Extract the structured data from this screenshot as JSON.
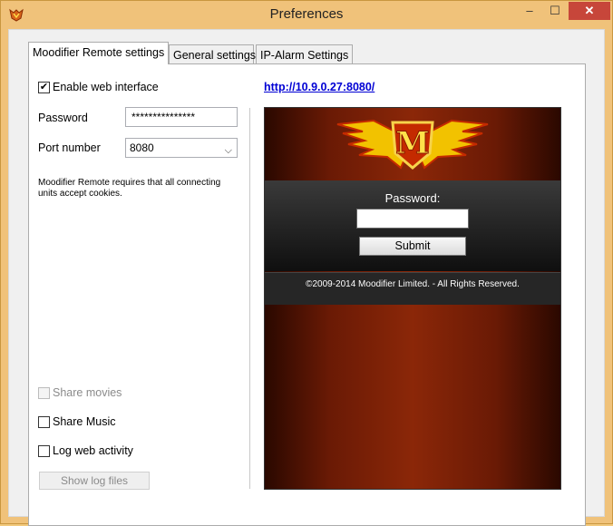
{
  "window": {
    "title": "Preferences",
    "controls": {
      "minimize": "–",
      "maximize": "☐",
      "close": "✕"
    }
  },
  "tabs": [
    {
      "label": "Moodifier Remote settings",
      "active": true
    },
    {
      "label": "General settings",
      "active": false
    },
    {
      "label": "IP-Alarm Settings",
      "active": false
    }
  ],
  "left": {
    "enable_web": {
      "label": "Enable web interface",
      "checked": true
    },
    "password": {
      "label": "Password",
      "value": "***************"
    },
    "port": {
      "label": "Port number",
      "value": "8080"
    },
    "note": "Moodifier Remote requires that all connecting units accept cookies.",
    "share_movies": {
      "label": "Share movies",
      "checked": false,
      "disabled": true
    },
    "share_music": {
      "label": "Share Music",
      "checked": false
    },
    "log_activity": {
      "label": "Log web activity",
      "checked": false
    },
    "show_log_button": "Show log files"
  },
  "right": {
    "url": "http://10.9.0.27:8080/",
    "preview": {
      "logo_letter": "M",
      "password_label": "Password:",
      "submit_label": "Submit",
      "footer": "©2009-2014 Moodifier Limited. - All Rights Reserved."
    }
  },
  "colors": {
    "accent": "#f0c27a",
    "link": "#0000d4",
    "close": "#c7463a"
  }
}
